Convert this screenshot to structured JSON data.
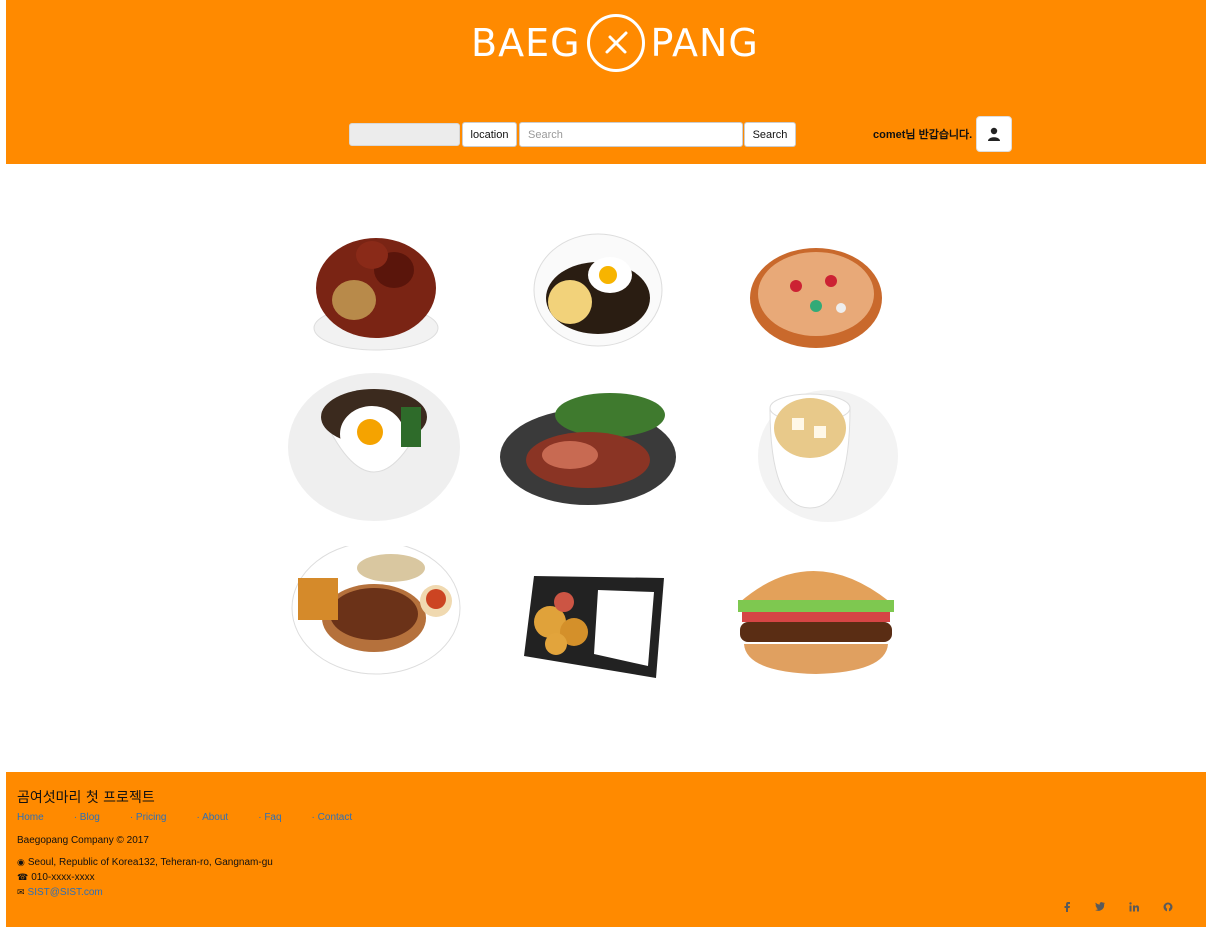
{
  "header": {
    "logo_left": "BAEG",
    "logo_right": "PANG",
    "location_value": "",
    "location_button": "location",
    "search_placeholder": "Search",
    "search_button": "Search",
    "greeting": "comet님 반갑습니다."
  },
  "foods": [
    {
      "name": "sweet-sour-chicken"
    },
    {
      "name": "jajangmyeon"
    },
    {
      "name": "pizza"
    },
    {
      "name": "bibimbap"
    },
    {
      "name": "roast-duck"
    },
    {
      "name": "soup-cup"
    },
    {
      "name": "pork-cutlet"
    },
    {
      "name": "lunch-box"
    },
    {
      "name": "hamburger"
    }
  ],
  "footer": {
    "title": "곰여섯마리 첫 프로젝트",
    "links": [
      "Home",
      "Blog",
      "Pricing",
      "About",
      "Faq",
      "Contact"
    ],
    "company": "Baegopang Company © 2017",
    "address": "Seoul, Republic of Korea132, Teheran-ro, Gangnam-gu",
    "phone": "010-xxxx-xxxx",
    "email": "SIST@SIST.com",
    "social": [
      "f",
      "t",
      "in",
      "gh"
    ]
  },
  "colors": {
    "brand": "#ff8a00",
    "link": "#2e6fb5"
  }
}
